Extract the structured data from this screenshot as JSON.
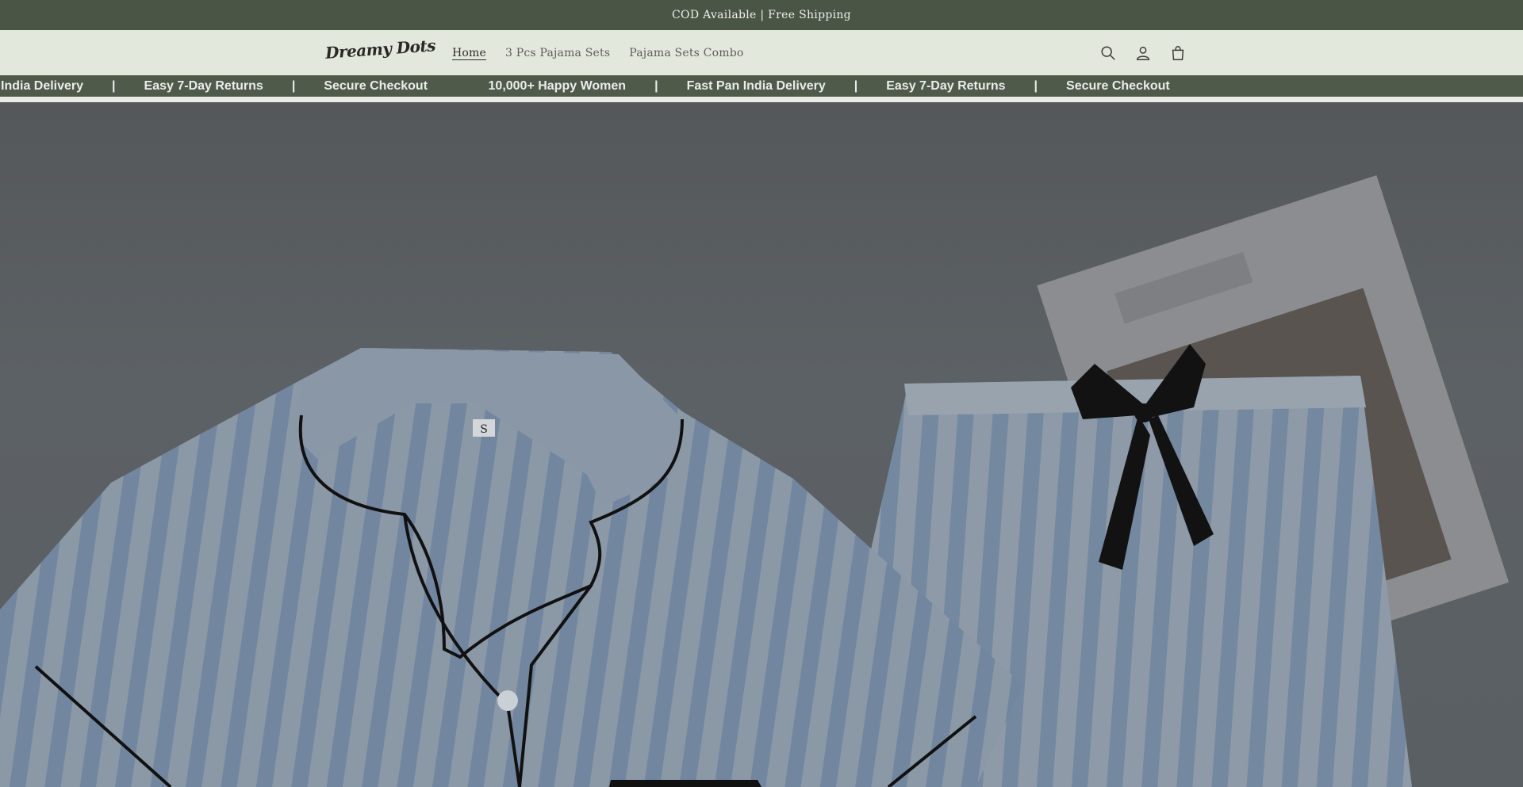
{
  "announcement": {
    "text": "COD Available | Free Shipping"
  },
  "header": {
    "logo": "Dreamy Dots",
    "nav": [
      {
        "label": "Home",
        "active": true
      },
      {
        "label": "3 Pcs Pajama Sets",
        "active": false
      },
      {
        "label": "Pajama Sets Combo",
        "active": false
      }
    ],
    "icons": [
      "search-icon",
      "account-icon",
      "cart-icon"
    ]
  },
  "marquee": {
    "items": [
      "India Delivery",
      " Easy 7-Day Returns",
      " Secure Checkout",
      " 10,000+ Happy Women",
      " Fast Pan India Delivery",
      " Easy 7-Day Returns",
      " Secure Checkout"
    ],
    "separator": "|"
  },
  "hero": {
    "tag_letter": "S"
  },
  "colors": {
    "announcement_bg": "#4a5546",
    "header_bg": "#e3e8dc",
    "marquee_bg": "#4f5a4b"
  }
}
